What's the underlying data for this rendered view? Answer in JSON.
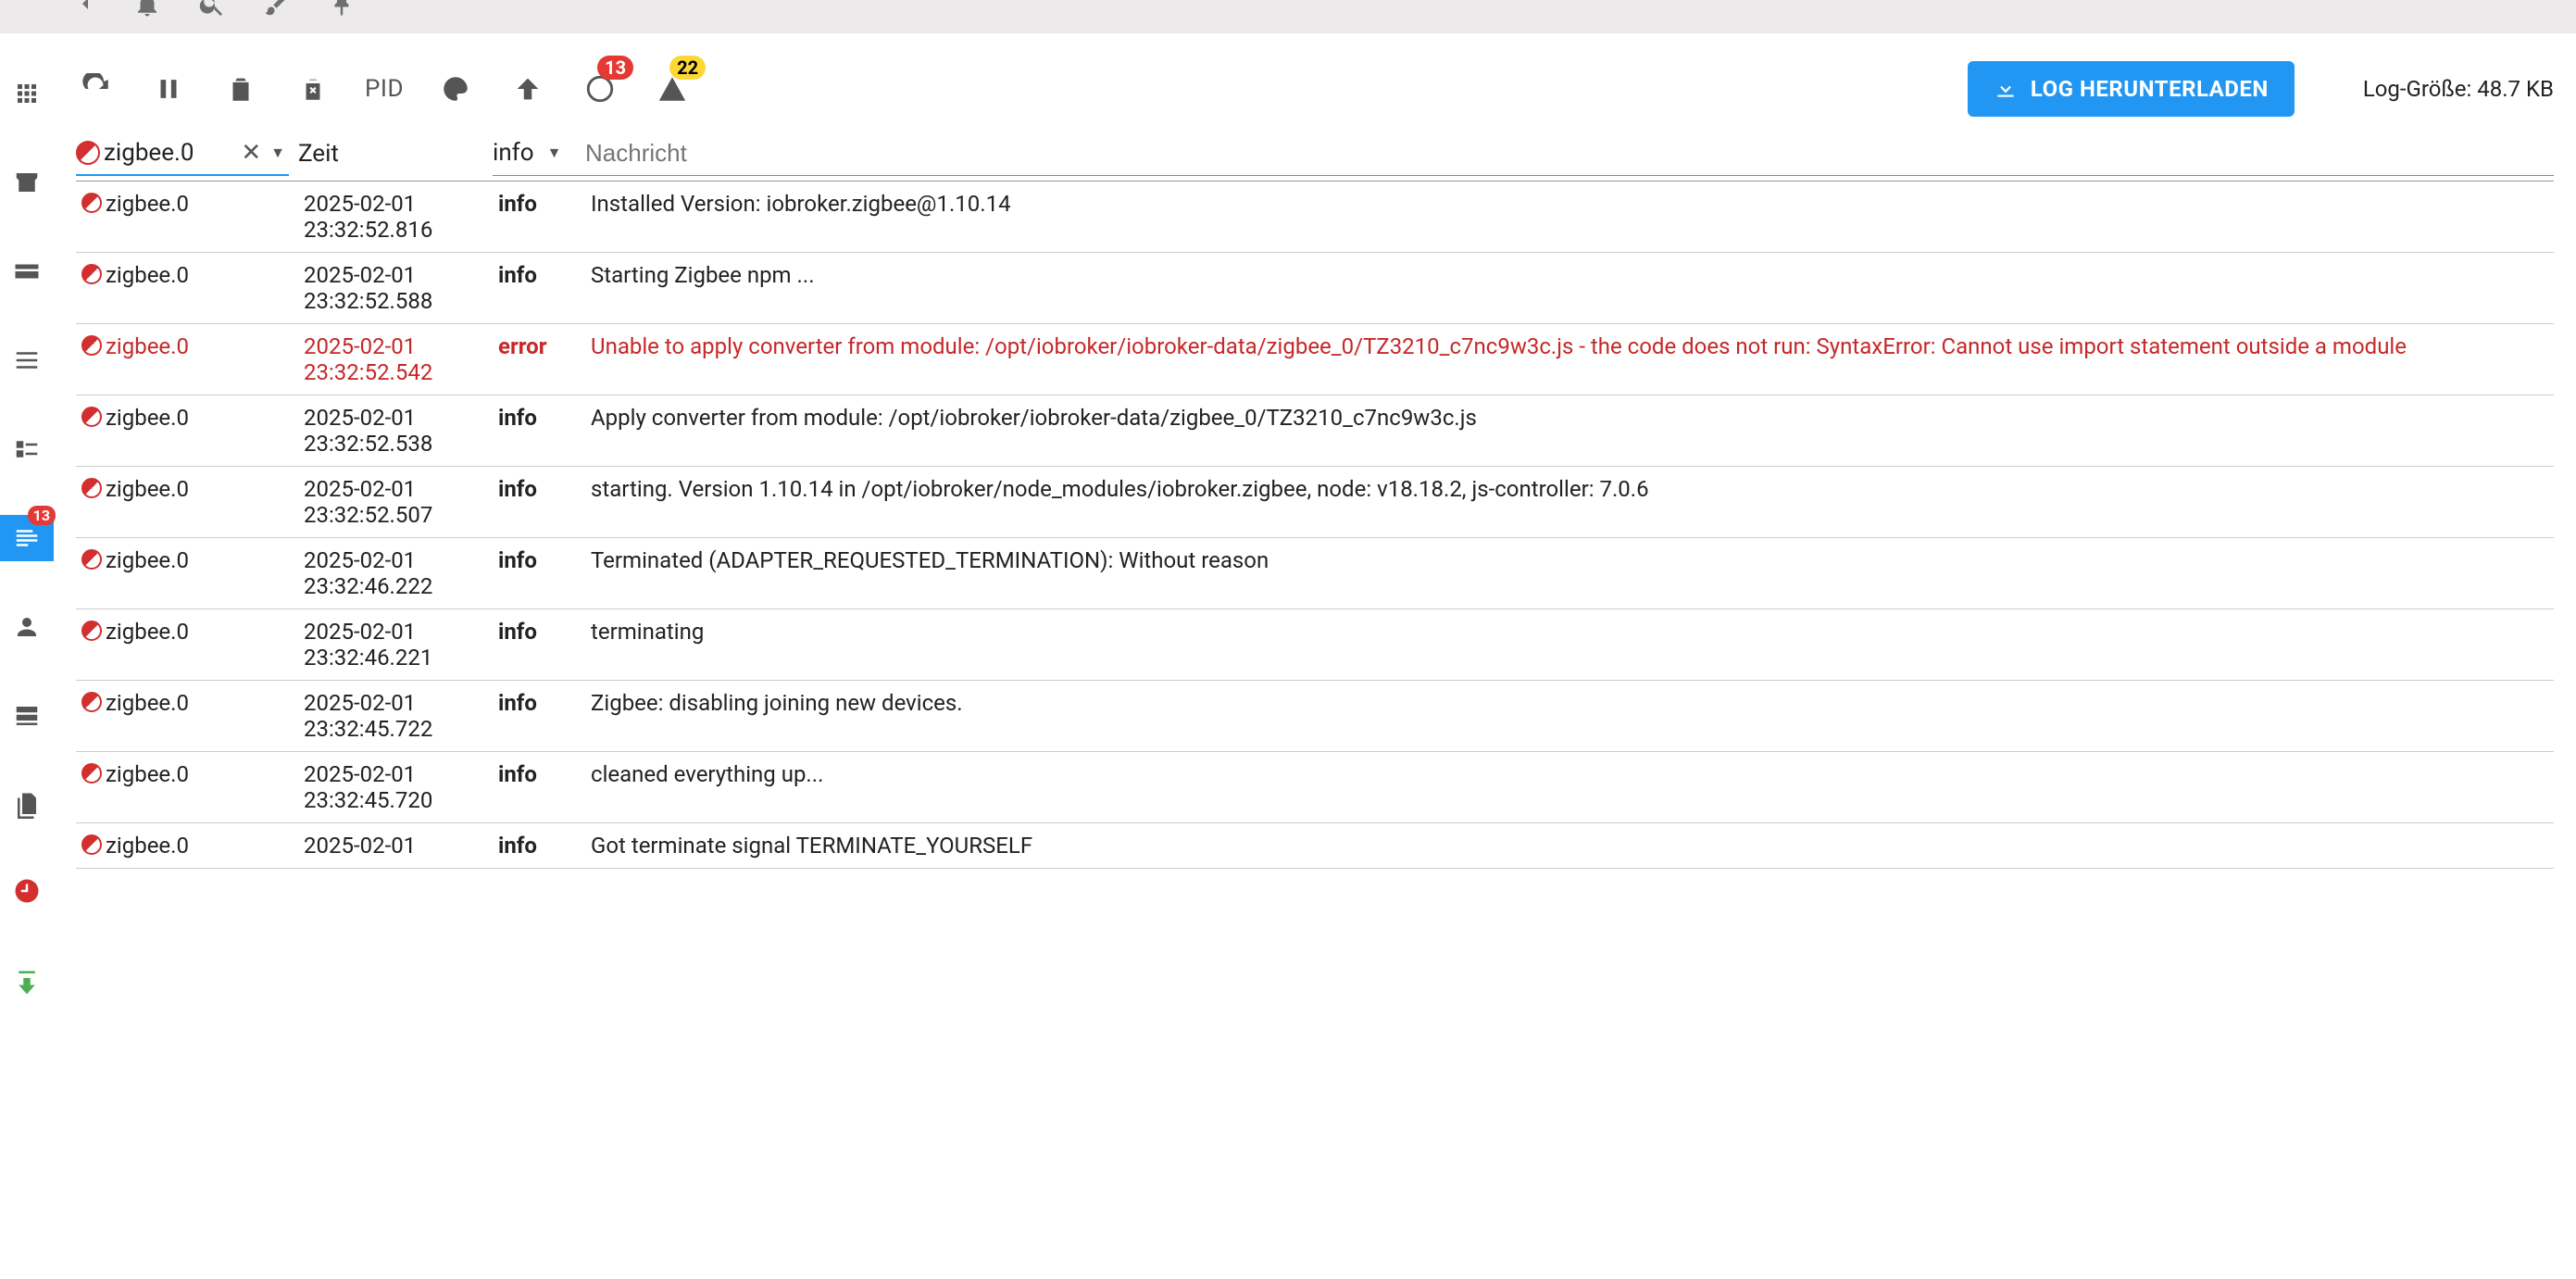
{
  "sidebar": {
    "badge": "13"
  },
  "toolbar": {
    "pid_label": "PID",
    "error_badge": "13",
    "warning_badge": "22",
    "download_label": "LOG HERUNTERLADEN",
    "log_size_label": "Log-Größe: 48.7 KB"
  },
  "filters": {
    "source_value": "zigbee.0",
    "time_header": "Zeit",
    "level_value": "info",
    "message_placeholder": "Nachricht"
  },
  "rows": [
    {
      "source": "zigbee.0",
      "date": "2025-02-01",
      "time": "23:32:52.816",
      "level": "info",
      "msg": "Installed Version: iobroker.zigbee@1.10.14",
      "error": false
    },
    {
      "source": "zigbee.0",
      "date": "2025-02-01",
      "time": "23:32:52.588",
      "level": "info",
      "msg": "Starting Zigbee npm ...",
      "error": false
    },
    {
      "source": "zigbee.0",
      "date": "2025-02-01",
      "time": "23:32:52.542",
      "level": "error",
      "msg": "Unable to apply converter from module: /opt/iobroker/iobroker-data/zigbee_0/TZ3210_c7nc9w3c.js - the code does not run: SyntaxError: Cannot use import statement outside a module",
      "error": true
    },
    {
      "source": "zigbee.0",
      "date": "2025-02-01",
      "time": "23:32:52.538",
      "level": "info",
      "msg": "Apply converter from module: /opt/iobroker/iobroker-data/zigbee_0/TZ3210_c7nc9w3c.js",
      "error": false
    },
    {
      "source": "zigbee.0",
      "date": "2025-02-01",
      "time": "23:32:52.507",
      "level": "info",
      "msg": "starting. Version 1.10.14 in /opt/iobroker/node_modules/iobroker.zigbee, node: v18.18.2, js-controller: 7.0.6",
      "error": false
    },
    {
      "source": "zigbee.0",
      "date": "2025-02-01",
      "time": "23:32:46.222",
      "level": "info",
      "msg": "Terminated (ADAPTER_REQUESTED_TERMINATION): Without reason",
      "error": false
    },
    {
      "source": "zigbee.0",
      "date": "2025-02-01",
      "time": "23:32:46.221",
      "level": "info",
      "msg": "terminating",
      "error": false
    },
    {
      "source": "zigbee.0",
      "date": "2025-02-01",
      "time": "23:32:45.722",
      "level": "info",
      "msg": "Zigbee: disabling joining new devices.",
      "error": false
    },
    {
      "source": "zigbee.0",
      "date": "2025-02-01",
      "time": "23:32:45.720",
      "level": "info",
      "msg": "cleaned everything up...",
      "error": false
    },
    {
      "source": "zigbee.0",
      "date": "2025-02-01",
      "time": "",
      "level": "info",
      "msg": "Got terminate signal TERMINATE_YOURSELF",
      "error": false
    }
  ]
}
